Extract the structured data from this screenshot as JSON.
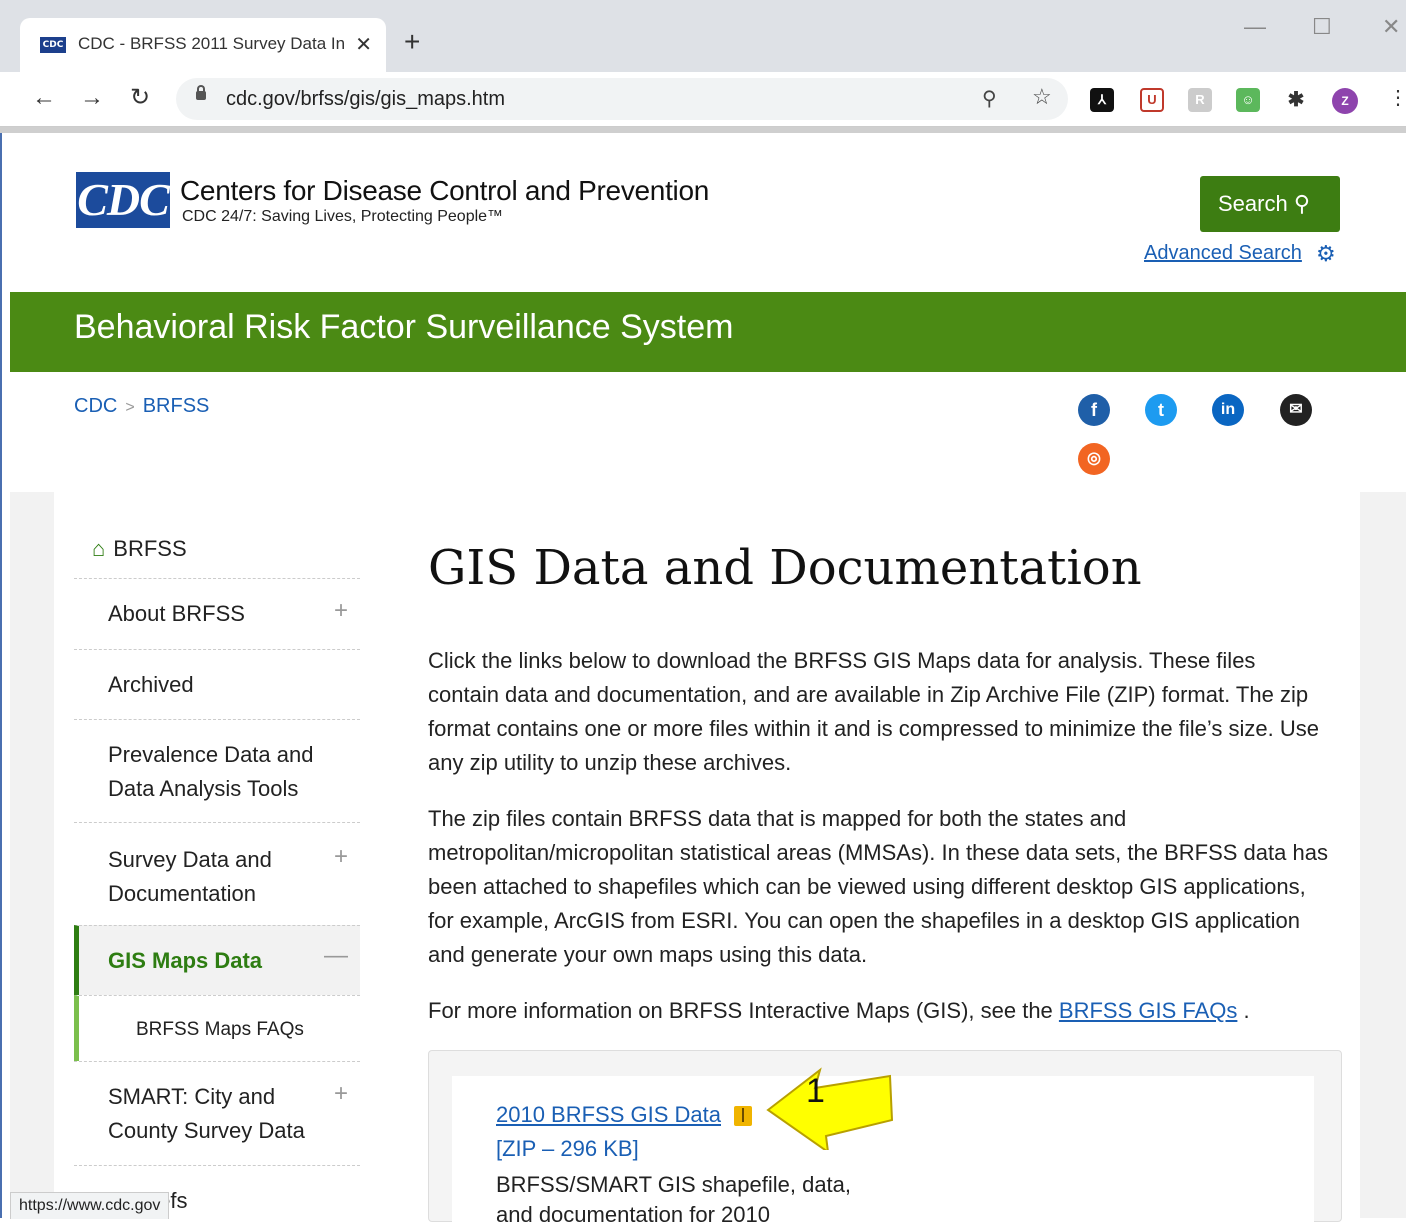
{
  "browser": {
    "tab_favicon_text": "CDC",
    "tab_title": "CDC - BRFSS 2011 Survey Data In",
    "tab_close": "✕",
    "new_tab": "+",
    "url": "cdc.gov/brfss/gis/gis_maps.htm",
    "minimize": "—",
    "maximize": "☐",
    "close_window": "✕",
    "profile_initial": "Z",
    "status_url": "https://www.cdc.gov"
  },
  "header": {
    "logo_text": "CDC",
    "site_name": "Centers for Disease Control and Prevention",
    "tagline": "CDC 24/7: Saving Lives, Protecting People™",
    "search_label": "Search",
    "advanced_search": "Advanced Search"
  },
  "banner": {
    "title": "Behavioral Risk Factor Surveillance System"
  },
  "breadcrumb": {
    "items": [
      "CDC",
      "BRFSS"
    ],
    "separator": ">"
  },
  "social": {
    "icons": [
      "facebook-icon",
      "twitter-icon",
      "linkedin-icon",
      "email-icon",
      "syndicate-icon"
    ]
  },
  "sidebar": {
    "home": "BRFSS",
    "items": [
      {
        "label": "About BRFSS",
        "toggle": "+"
      },
      {
        "label": "Archived",
        "toggle": ""
      },
      {
        "label": "Prevalence Data and Data Analysis Tools",
        "toggle": ""
      },
      {
        "label": "Survey Data and Documentation",
        "toggle": "+"
      },
      {
        "label": "GIS Maps Data",
        "toggle": "—"
      },
      {
        "label": "BRFSS Maps FAQs",
        "toggle": ""
      },
      {
        "label": "SMART: City and County Survey Data",
        "toggle": "+"
      },
      {
        "label": "al Briefs",
        "toggle": ""
      }
    ]
  },
  "main": {
    "title": "GIS Data and Documentation",
    "para1": "Click the links below to download the BRFSS GIS Maps data for analysis. These files contain data and documentation, and are available in Zip Archive File (ZIP) format. The zip format contains one or more files within it and is compressed to minimize the file’s size. Use any zip utility to unzip these archives.",
    "para2": "The zip files contain BRFSS data that is mapped for both the states and metropolitan/micropolitan statistical areas (MMSAs). In these data sets, the BRFSS data has been attached to shapefiles which can be viewed using different desktop GIS applications, for example, ArcGIS from ESRI. You can open the shapefiles in a desktop GIS application and generate your own maps using this data.",
    "para3_prefix": "For more information on BRFSS Interactive Maps (GIS), see the ",
    "para3_link": "BRFSS GIS FAQs",
    "para3_suffix": " .",
    "file": {
      "link": "2010 BRFSS GIS Data",
      "size": "[ZIP – 296 KB]",
      "desc_line1": "BRFSS/SMART GIS shapefile, data,",
      "desc_line2": "and documentation for 2010"
    }
  },
  "annotation": {
    "callout_number": "1",
    "arrow_color": "#ffff00"
  },
  "colors": {
    "brand_green": "#4b8a14",
    "link_blue": "#1a5fb4",
    "cdc_blue": "#1c4b9c"
  }
}
